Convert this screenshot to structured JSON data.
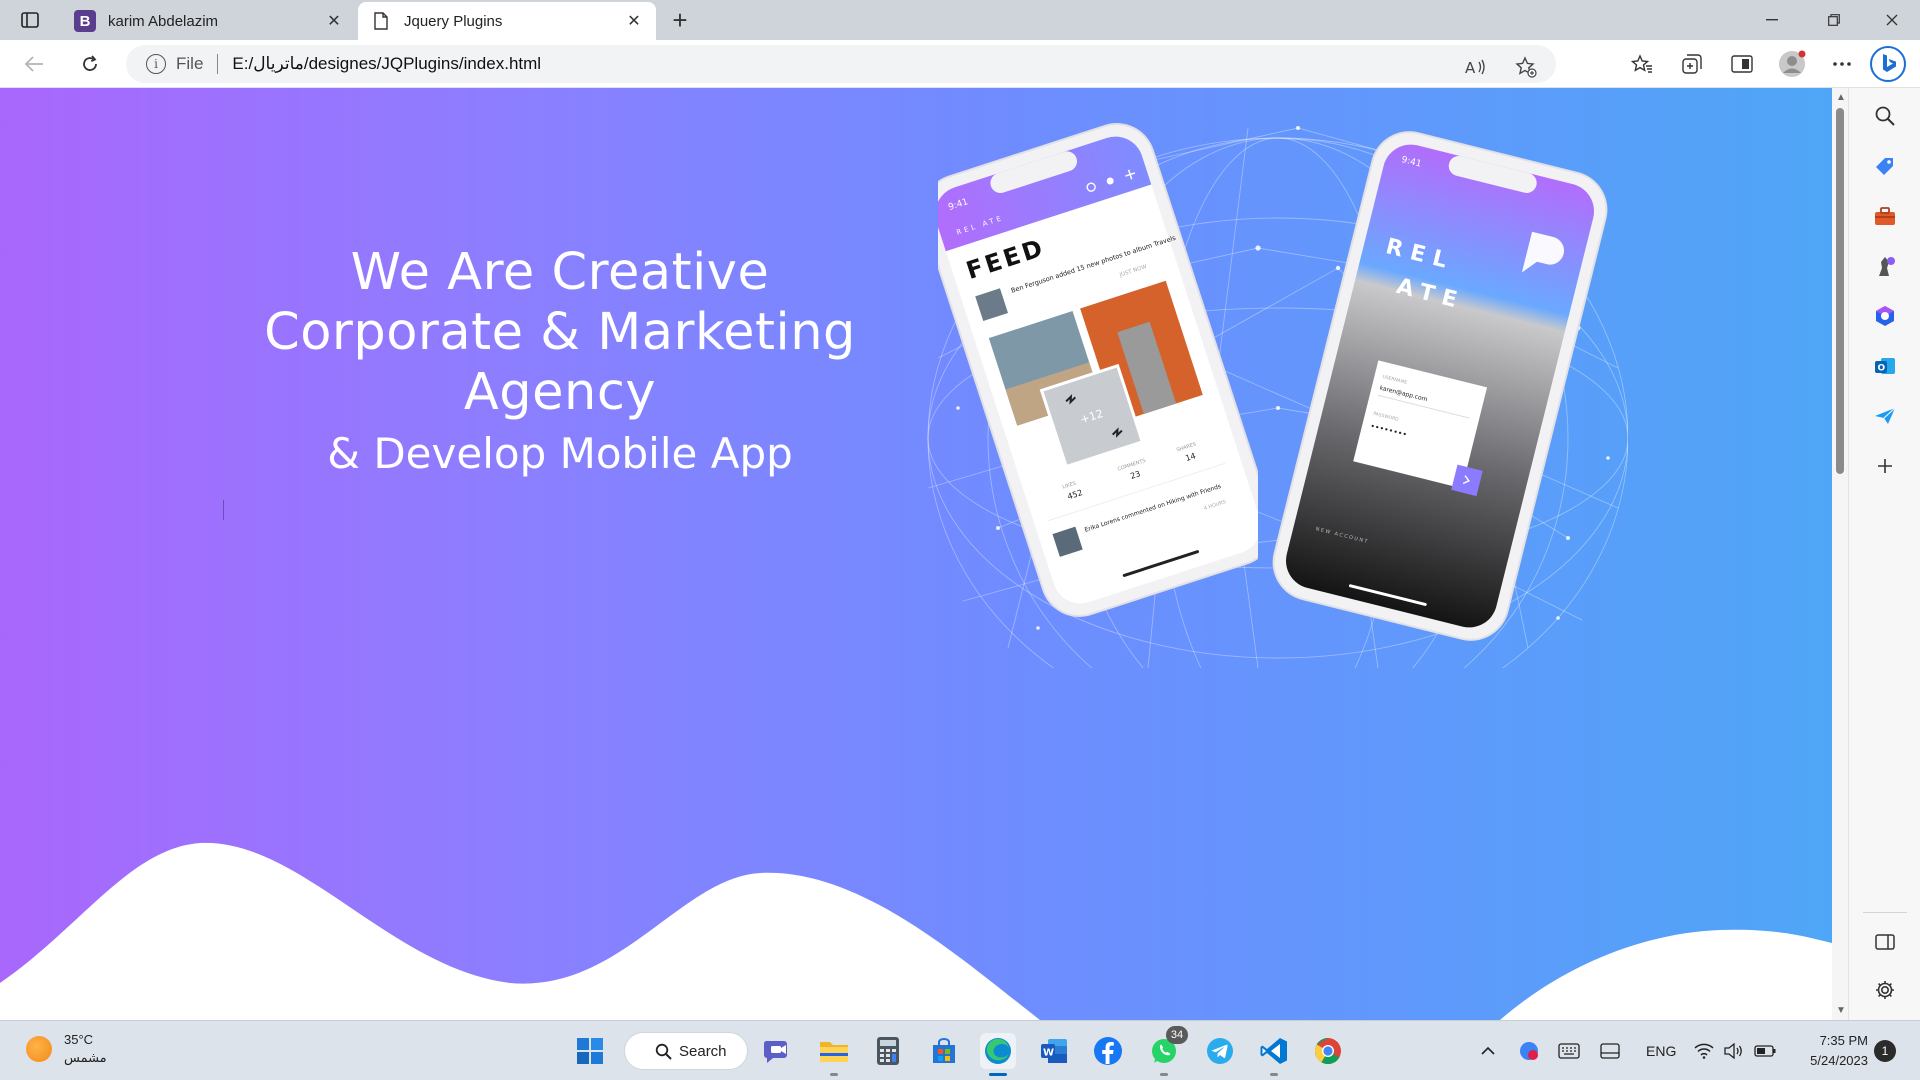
{
  "browser": {
    "tabs": [
      {
        "title": "karim Abdelazim",
        "favicon": "B"
      },
      {
        "title": "Jquery Plugins"
      }
    ],
    "address": {
      "scheme_label": "File",
      "url": "E:/ماتريال/designes/JQPlugins/index.html"
    }
  },
  "page": {
    "hero": {
      "line1": "We Are Creative",
      "line2": "Corporate & Marketing",
      "line3": "Agency",
      "line4": "& Develop Mobile App"
    },
    "phone_left": {
      "time": "9:41",
      "brand": "REL ATE",
      "title": "FEED",
      "post_text": "Ben Ferguson added 15 new photos to album Travels",
      "post_time": "JUST NOW",
      "more_photos": "+12",
      "stats": [
        {
          "label": "LIKES",
          "value": "452"
        },
        {
          "label": "COMMENTS",
          "value": "23"
        },
        {
          "label": "SHARES",
          "value": "14"
        }
      ],
      "comment": "Erika Lorens commented on Hiking with Friends",
      "comment_time": "4 HOURS"
    },
    "phone_right": {
      "time": "9:41",
      "brand_line1": "REL",
      "brand_line2": "ATE",
      "username_label": "USERNAME",
      "username_value": "karen@app.com",
      "password_label": "PASSWORD",
      "password_value": "••••••••",
      "new_account": "NEW ACCOUNT"
    }
  },
  "taskbar": {
    "weather": {
      "temp": "35°C",
      "condition": "مشمس"
    },
    "search_label": "Search",
    "whatsapp_badge": "34",
    "tray": {
      "language": "ENG"
    },
    "clock": {
      "time": "7:35 PM",
      "date": "5/24/2023"
    },
    "notification_count": "1"
  },
  "colors": {
    "gradient_start": "#a967fc",
    "gradient_end": "#4fa6f7",
    "accent_blue": "#0067c0"
  }
}
